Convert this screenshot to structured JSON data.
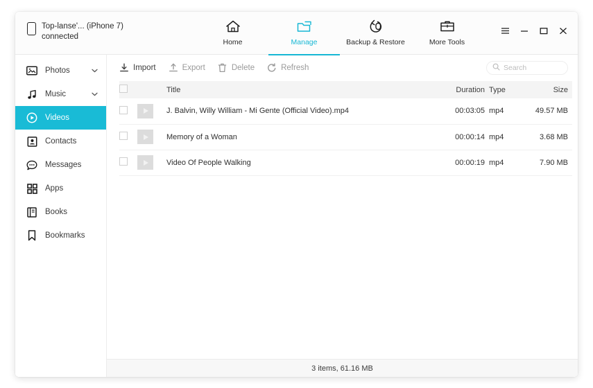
{
  "window": {
    "device_line1": "Top-lanse'... (iPhone 7)",
    "device_line2": "connected",
    "controls": {
      "menu": "menu-icon",
      "minimize": "minimize-icon",
      "maximize": "maximize-icon",
      "close": "close-icon"
    }
  },
  "accent_color": "#16b7d4",
  "tabs": [
    {
      "label": "Home",
      "icon": "home-icon",
      "active": false
    },
    {
      "label": "Manage",
      "icon": "folder-icon",
      "active": true
    },
    {
      "label": "Backup & Restore",
      "icon": "restore-icon",
      "active": false
    },
    {
      "label": "More Tools",
      "icon": "toolbox-icon",
      "active": false
    }
  ],
  "sidebar": {
    "items": [
      {
        "label": "Photos",
        "icon": "photos-icon",
        "chevron": "⌄",
        "active": false
      },
      {
        "label": "Music",
        "icon": "music-icon",
        "chevron": "⌄",
        "active": false
      },
      {
        "label": "Videos",
        "icon": "videos-icon",
        "chevron": "",
        "active": true
      },
      {
        "label": "Contacts",
        "icon": "contacts-icon",
        "chevron": "",
        "active": false
      },
      {
        "label": "Messages",
        "icon": "messages-icon",
        "chevron": "",
        "active": false
      },
      {
        "label": "Apps",
        "icon": "apps-icon",
        "chevron": "",
        "active": false
      },
      {
        "label": "Books",
        "icon": "books-icon",
        "chevron": "",
        "active": false
      },
      {
        "label": "Bookmarks",
        "icon": "bookmarks-icon",
        "chevron": "",
        "active": false
      }
    ]
  },
  "toolbar": {
    "buttons": [
      {
        "label": "Import",
        "icon": "import-icon",
        "enabled": true
      },
      {
        "label": "Export",
        "icon": "export-icon",
        "enabled": false
      },
      {
        "label": "Delete",
        "icon": "trash-icon",
        "enabled": false
      },
      {
        "label": "Refresh",
        "icon": "refresh-icon",
        "enabled": false
      }
    ],
    "search": {
      "value": "",
      "placeholder": "Search",
      "icon": "search-icon"
    }
  },
  "table": {
    "headers": {
      "title": "Title",
      "duration": "Duration",
      "type": "Type",
      "size": "Size"
    },
    "rows": [
      {
        "title": "J. Balvin, Willy William - Mi Gente (Official Video).mp4",
        "duration": "00:03:05",
        "type": "mp4",
        "size": "49.57 MB",
        "checked": false
      },
      {
        "title": "Memory of a Woman",
        "duration": "00:00:14",
        "type": "mp4",
        "size": "3.68 MB",
        "checked": false
      },
      {
        "title": "Video Of People Walking",
        "duration": "00:00:19",
        "type": "mp4",
        "size": "7.90 MB",
        "checked": false
      }
    ]
  },
  "status": {
    "text": "3 items, 61.16 MB"
  }
}
